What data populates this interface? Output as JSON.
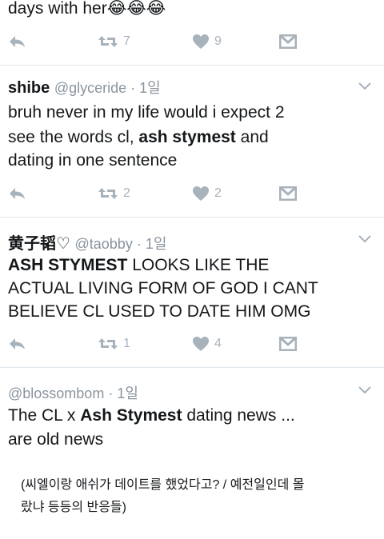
{
  "colors": {
    "action_gray": "#a8b2bb",
    "meta_gray": "#8a949e",
    "divider": "#e1e8ed"
  },
  "tweets": [
    {
      "text_parts": [
        {
          "t": "days with her"
        },
        {
          "t": "😂😂😂"
        }
      ],
      "actions": {
        "retweets": "7",
        "likes": "9"
      }
    },
    {
      "name": "shibe",
      "meta": "@glyceride · 1일",
      "lines": [
        [
          {
            "t": "bruh never in my life would i expect 2"
          }
        ],
        [
          {
            "t": "see the words cl, "
          },
          {
            "t": "ash stymest",
            "b": true
          },
          {
            "t": " and"
          }
        ],
        [
          {
            "t": "dating in one sentence"
          }
        ]
      ],
      "actions": {
        "retweets": "2",
        "likes": "2"
      }
    },
    {
      "name": "黄子韬♡",
      "meta": "@taobby · 1일",
      "lines": [
        [
          {
            "t": "ASH STYMEST",
            "b": true
          },
          {
            "t": " LOOKS LIKE THE"
          }
        ],
        [
          {
            "t": "ACTUAL LIVING FORM OF GOD I CANT"
          }
        ],
        [
          {
            "t": "BELIEVE CL USED TO DATE HIM OMG"
          }
        ]
      ],
      "actions": {
        "retweets": "1",
        "likes": "4"
      }
    },
    {
      "meta": "@blossombom · 1일",
      "lines": [
        [
          {
            "t": "The CL x "
          },
          {
            "t": "Ash Stymest",
            "b": true
          },
          {
            "t": " dating news ..."
          }
        ],
        [
          {
            "t": "are old news"
          }
        ]
      ]
    }
  ],
  "footnote": {
    "line1": "(씨엘이랑 애쉬가 데이트를 했었다고? / 예전일인데 몰",
    "line2": "랐냐 등등의 반응들)"
  },
  "icons": [
    "reply-icon",
    "retweet-icon",
    "like-icon",
    "dm-icon",
    "chevron-down-icon"
  ]
}
